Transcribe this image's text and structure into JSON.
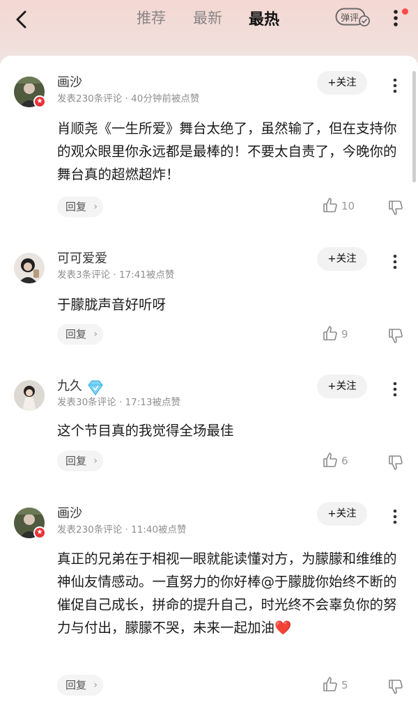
{
  "tabs": [
    {
      "label": "推荐",
      "active": false
    },
    {
      "label": "最新",
      "active": false
    },
    {
      "label": "最热",
      "active": true
    }
  ],
  "danmu_label": "弹评",
  "follow_label": "+关注",
  "reply_label": "回复",
  "comments": [
    {
      "username": "画沙",
      "meta": "发表230条评论 · 40分钟前被点赞",
      "content": "肖顺尧《一生所爱》舞台太绝了，虽然输了，但在支持你的观众眼里你永远都是最棒的！不要太自责了，今晚你的舞台真的超燃超炸！",
      "likes": "10"
    },
    {
      "username": "可可爱爱",
      "meta": "发表3条评论 · 17:41被点赞",
      "content": "于朦胧声音好听呀",
      "likes": "9"
    },
    {
      "username": "九久",
      "meta": "发表30条评论 · 17:13被点赞",
      "content": "这个节目真的我觉得全场最佳",
      "likes": "6"
    },
    {
      "username": "画沙",
      "meta": "发表230条评论 · 11:40被点赞",
      "content": "真正的兄弟在于相视一眼就能读懂对方，为朦朦和维维的神仙友情感动。一直努力的你好棒@于朦胧你始终不断的催促自己成长，拼命的提升自己，时光终不会辜负你的努力与付出，朦朦不哭，未来一起加油❤️",
      "likes": "5"
    }
  ]
}
